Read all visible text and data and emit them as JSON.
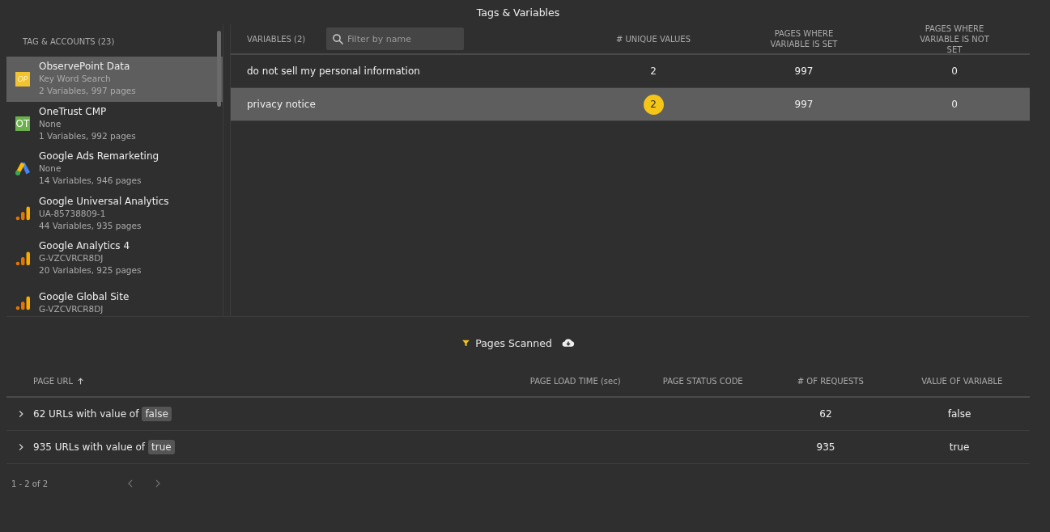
{
  "window": {
    "title": "Tags & Variables"
  },
  "sidebar": {
    "heading": "TAG & ACCOUNTS (23)",
    "items": [
      {
        "kind": "op",
        "icon_text": "OP",
        "name": "ObservePoint Data",
        "account": "Key Word Search",
        "summary": "2 Variables, 997 pages",
        "selected": true
      },
      {
        "kind": "ot",
        "icon_text": "OT",
        "name": "OneTrust CMP",
        "account": "None",
        "summary": "1 Variables, 992 pages",
        "selected": false
      },
      {
        "kind": "ads",
        "name": "Google Ads Remarketing",
        "account": "None",
        "summary": "14 Variables, 946 pages",
        "selected": false
      },
      {
        "kind": "analytics",
        "name": "Google Universal Analytics",
        "account": "UA-85738809-1",
        "summary": "44 Variables, 935 pages",
        "selected": false
      },
      {
        "kind": "analytics",
        "name": "Google Analytics 4",
        "account": "G-VZCVRCR8DJ",
        "summary": "20 Variables, 925 pages",
        "selected": false
      },
      {
        "kind": "analytics",
        "name": "Google Global Site",
        "account": "G-VZCVRCR8DJ",
        "selected": false
      }
    ]
  },
  "variables": {
    "columns": [
      "VARIABLES (2)",
      "# UNIQUE VALUES",
      "PAGES WHERE VARIABLE IS SET",
      "PAGES WHERE VARIABLE IS NOT SET"
    ],
    "filter": {
      "placeholder": "Filter by name"
    },
    "rows": [
      {
        "name": "do not sell my personal information",
        "unique": "2",
        "set": "997",
        "not_set": "0",
        "selected": false
      },
      {
        "name": "privacy notice",
        "unique": "2",
        "set": "997",
        "not_set": "0",
        "selected": true
      }
    ]
  },
  "pages": {
    "title": "Pages Scanned",
    "columns": [
      "PAGE URL",
      "PAGE LOAD TIME (sec)",
      "PAGE STATUS CODE",
      "# OF REQUESTS",
      "VALUE OF VARIABLE"
    ],
    "rows": [
      {
        "label": "62 URLs with value of",
        "value_tag": "false",
        "requests": "62",
        "value": "false",
        "expanded": false
      },
      {
        "label": "935 URLs with value of",
        "value_tag": "true",
        "requests": "935",
        "value": "true",
        "expanded": false
      }
    ],
    "pagination": "1 - 2 of 2"
  }
}
